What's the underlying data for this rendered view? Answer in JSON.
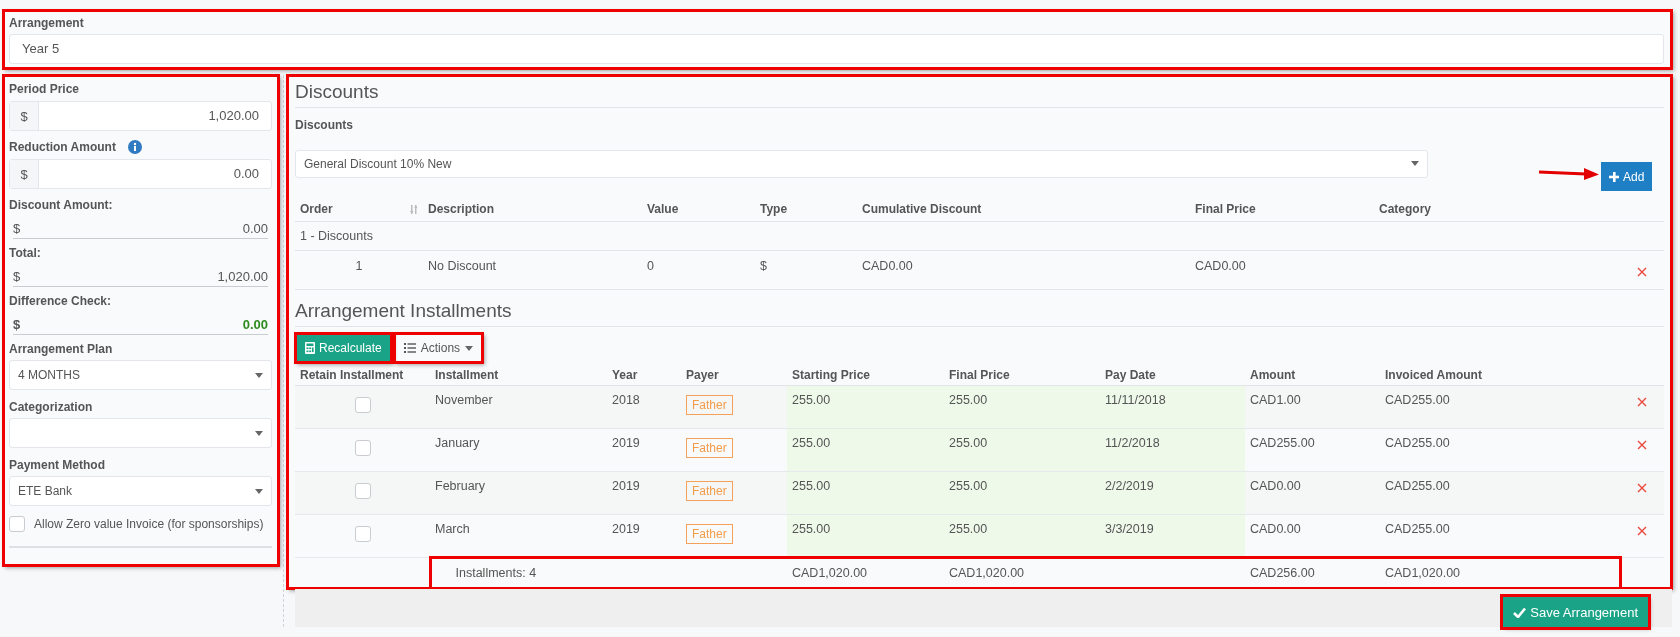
{
  "arrangement": {
    "label": "Arrangement",
    "value": "Year 5"
  },
  "sidebar": {
    "fields": [
      {
        "kind": "money_input",
        "label": "Period Price",
        "prefix": "$",
        "value": "1,020.00"
      },
      {
        "kind": "money_input",
        "label": "Reduction Amount",
        "info": true,
        "prefix": "$",
        "value": "0.00"
      },
      {
        "kind": "readout",
        "label": "Discount Amount:",
        "prefix": "$",
        "value": "0.00"
      },
      {
        "kind": "readout",
        "label": "Total:",
        "prefix": "$",
        "value": "1,020.00"
      },
      {
        "kind": "readout",
        "label": "Difference Check:",
        "prefix": "$",
        "value": "0.00",
        "valid": true
      },
      {
        "kind": "select",
        "label": "Arrangement Plan",
        "value": "4 MONTHS"
      },
      {
        "kind": "select",
        "label": "Categorization"
      },
      {
        "kind": "select",
        "label": "Payment Method",
        "value": "ETE Bank"
      },
      {
        "kind": "checkbox",
        "label": "Allow Zero value Invoice (for sponsorships)",
        "checked": false
      }
    ]
  },
  "discounts": {
    "title": "Discounts",
    "field_label": "Discounts",
    "selected_discount": "General Discount 10% New",
    "add_button": "Add",
    "columns": [
      "Order",
      "Description",
      "Value",
      "Type",
      "Cumulative Discount",
      "Final Price",
      "Category"
    ],
    "groups": [
      {
        "label": "1 - Discounts",
        "rows": [
          {
            "order": "1",
            "description": "No Discount",
            "value": "0",
            "type": "$",
            "cumulative_discount": "CAD0.00",
            "final_price": "CAD0.00"
          }
        ]
      }
    ]
  },
  "installments": {
    "title": "Arrangement Installments",
    "recalculate_button": "Recalculate",
    "actions_button": "Actions",
    "columns": [
      "Retain Installment",
      "Installment",
      "Year",
      "Payer",
      "Starting Price",
      "Final Price",
      "Pay Date",
      "Amount",
      "Invoiced Amount"
    ],
    "rows": [
      {
        "retain": false,
        "installment": "November",
        "year": "2018",
        "payer": "Father",
        "starting_price": "255.00",
        "final_price": "255.00",
        "pay_date": "11/11/2018",
        "amount": "CAD1.00",
        "invoiced_amount": "CAD255.00"
      },
      {
        "retain": false,
        "installment": "January",
        "year": "2019",
        "payer": "Father",
        "starting_price": "255.00",
        "final_price": "255.00",
        "pay_date": "11/2/2018",
        "amount": "CAD255.00",
        "invoiced_amount": "CAD255.00"
      },
      {
        "retain": false,
        "installment": "February",
        "year": "2019",
        "payer": "Father",
        "starting_price": "255.00",
        "final_price": "255.00",
        "pay_date": "2/2/2019",
        "amount": "CAD0.00",
        "invoiced_amount": "CAD255.00"
      },
      {
        "retain": false,
        "installment": "March",
        "year": "2019",
        "payer": "Father",
        "starting_price": "255.00",
        "final_price": "255.00",
        "pay_date": "3/3/2019",
        "amount": "CAD0.00",
        "invoiced_amount": "CAD255.00"
      }
    ],
    "totals": {
      "installment": "Installments: 4",
      "starting_price": "CAD1,020.00",
      "final_price": "CAD1,020.00",
      "amount": "CAD256.00",
      "invoiced_amount": "CAD1,020.00"
    }
  },
  "save_button": "Save Arrangement"
}
